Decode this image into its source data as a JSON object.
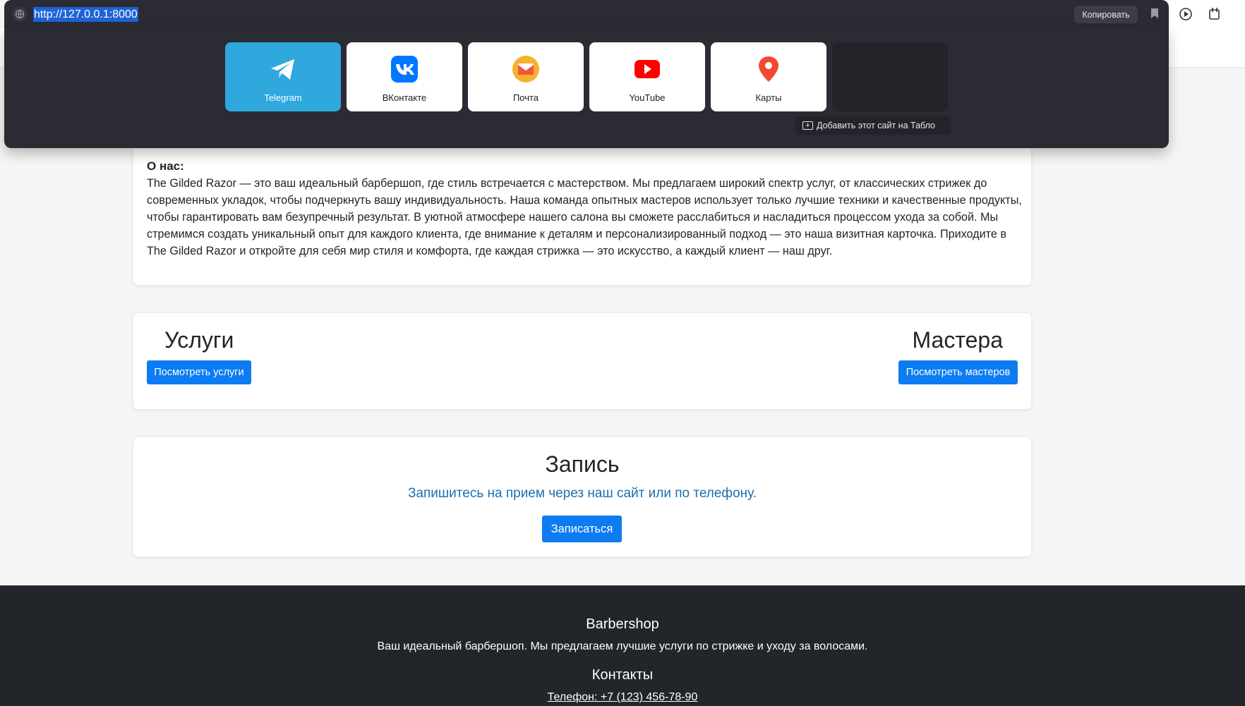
{
  "browser": {
    "url": "http://127.0.0.1:8000",
    "copy_label": "Копировать",
    "tiles": [
      {
        "label": "Telegram",
        "icon": "telegram-icon"
      },
      {
        "label": "ВКонтакте",
        "icon": "vk-icon"
      },
      {
        "label": "Почта",
        "icon": "mail-icon"
      },
      {
        "label": "YouTube",
        "icon": "youtube-icon"
      },
      {
        "label": "Карты",
        "icon": "maps-pin-icon"
      }
    ],
    "add_site_label": "Добавить этот сайт на Табло"
  },
  "about": {
    "label": "О нас:",
    "text": "The Gilded Razor — это ваш идеальный барбершоп, где стиль встречается с мастерством. Мы предлагаем широкий спектр услуг, от классических стрижек до современных укладок, чтобы подчеркнуть вашу индивидуальность. Наша команда опытных мастеров использует только лучшие техники и качественные продукты, чтобы гарантировать вам безупречный результат. В уютной атмосфере нашего салона вы сможете расслабиться и насладиться процессом ухода за собой. Мы стремимся создать уникальный опыт для каждого клиента, где внимание к деталям и персонализированный подход — это наша визитная карточка. Приходите в The Gilded Razor и откройте для себя мир стиля и комфорта, где каждая стрижка — это искусство, а каждый клиент — наш друг."
  },
  "services": {
    "title": "Услуги",
    "button": "Посмотреть услуги"
  },
  "masters": {
    "title": "Мастера",
    "button": "Посмотреть мастеров"
  },
  "booking": {
    "title": "Запись",
    "text": "Запишитесь на прием через наш сайт или по телефону.",
    "button": "Записаться"
  },
  "footer": {
    "brand": "Barbershop",
    "description": "Ваш идеальный барбершоп. Мы предлагаем лучшие услуги по стрижке и уходу за волосами.",
    "contacts_title": "Контакты",
    "phone": "Телефон: +7 (123) 456-78-90"
  },
  "colors": {
    "primary_button": "#0d7cf2",
    "link_text": "#1a6fb0",
    "footer_bg": "#222529",
    "popup_bg": "#2b2b33",
    "telegram_tile": "#2fa8de"
  }
}
